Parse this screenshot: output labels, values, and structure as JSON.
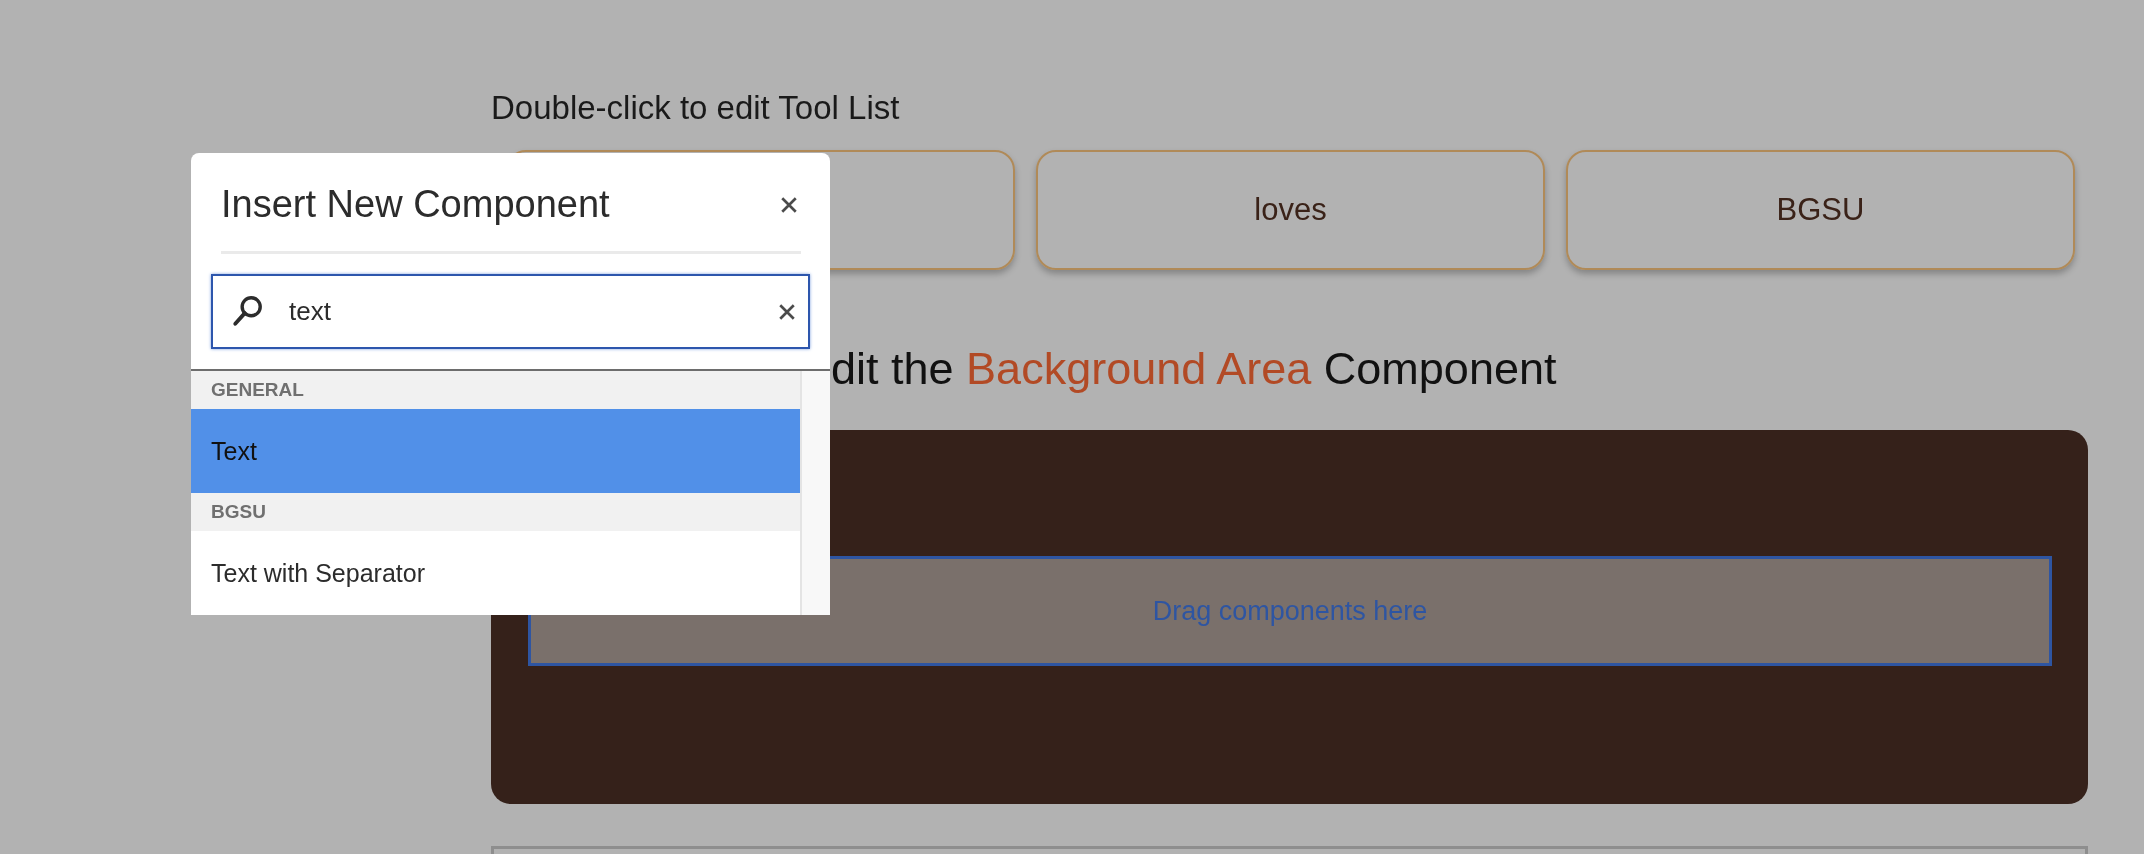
{
  "toolbox": {
    "hint": "Double-click to edit Tool List",
    "cards": [
      {
        "kind": "covered"
      },
      {
        "kind": "labeled",
        "label": "loves"
      },
      {
        "kind": "labeled",
        "label": "BGSU"
      }
    ]
  },
  "heading": {
    "parts": [
      {
        "text": "dit the ",
        "accent": false
      },
      {
        "text": "Background Area",
        "accent": true
      },
      {
        "text": " Component",
        "accent": false
      }
    ]
  },
  "container": {
    "placeholder": "Drag components here"
  },
  "dialog": {
    "title": "Insert New Component",
    "search": {
      "value": "text"
    },
    "groups": [
      {
        "name": "GENERAL",
        "items": [
          {
            "label": "Text",
            "selected": true
          }
        ]
      },
      {
        "name": "BGSU",
        "items": [
          {
            "label": "Text with Separator",
            "selected": false
          }
        ]
      }
    ]
  }
}
